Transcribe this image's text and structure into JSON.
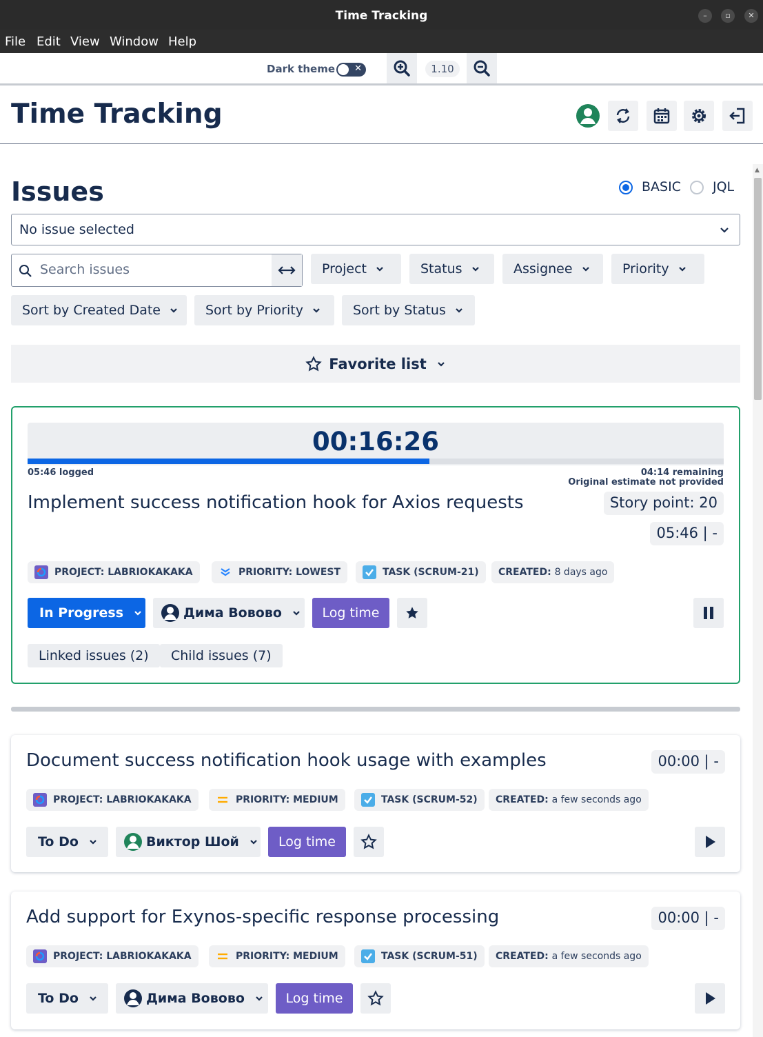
{
  "window": {
    "title": "Time Tracking"
  },
  "menu": [
    "File",
    "Edit",
    "View",
    "Window",
    "Help"
  ],
  "toolbar": {
    "dark_theme_label": "Dark theme",
    "dark_theme_on": false,
    "zoom": "1.10"
  },
  "header": {
    "title": "Time Tracking"
  },
  "issues": {
    "heading": "Issues",
    "mode_basic": "BASIC",
    "mode_jql": "JQL",
    "selected_mode": "BASIC",
    "select_value": "No issue selected",
    "search_placeholder": "Search issues",
    "filters": [
      "Project",
      "Status",
      "Assignee",
      "Priority"
    ],
    "sorts": [
      "Sort by Created Date",
      "Sort by Priority",
      "Sort by Status"
    ],
    "favorite_label": "Favorite list"
  },
  "active_issue": {
    "timer": "00:16:26",
    "progress_fraction": 0.577,
    "logged": "05:46 logged",
    "remaining": "04:14 remaining",
    "estimate_note": "Original estimate not provided",
    "title": "Implement success notification hook for Axios requests",
    "story_points": "Story point:  20",
    "time": "05:46 | -",
    "project": "PROJECT: LABRIOKAKAKA",
    "priority": "PRIORITY: LOWEST",
    "task": "TASK (SCRUM-21)",
    "created_label": "CREATED:",
    "created_value": "8 days ago",
    "status": "In Progress",
    "assignee": "Дима Вовово",
    "log_time": "Log time",
    "linked": "Linked issues (2)",
    "child": "Child issues (7)"
  },
  "issue_list": [
    {
      "title": "Document success notification hook usage with examples",
      "time": "00:00 | -",
      "project": "PROJECT: LABRIOKAKAKA",
      "priority": "PRIORITY: MEDIUM",
      "task": "TASK (SCRUM-52)",
      "created_label": "CREATED:",
      "created_value": "a few seconds ago",
      "status": "To Do",
      "assignee": "Виктор Шой",
      "log_time": "Log time"
    },
    {
      "title": "Add support for Exynos-specific response processing",
      "time": "00:00 | -",
      "project": "PROJECT: LABRIOKAKAKA",
      "priority": "PRIORITY: MEDIUM",
      "task": "TASK (SCRUM-51)",
      "created_label": "CREATED:",
      "created_value": "a few seconds ago",
      "status": "To Do",
      "assignee": "Дима Вовово",
      "log_time": "Log time"
    }
  ],
  "colors": {
    "accent": "#0c66e4",
    "log_button": "#6e5dc6",
    "active_border": "#22a06b",
    "avatar_green": "#1f845a"
  }
}
